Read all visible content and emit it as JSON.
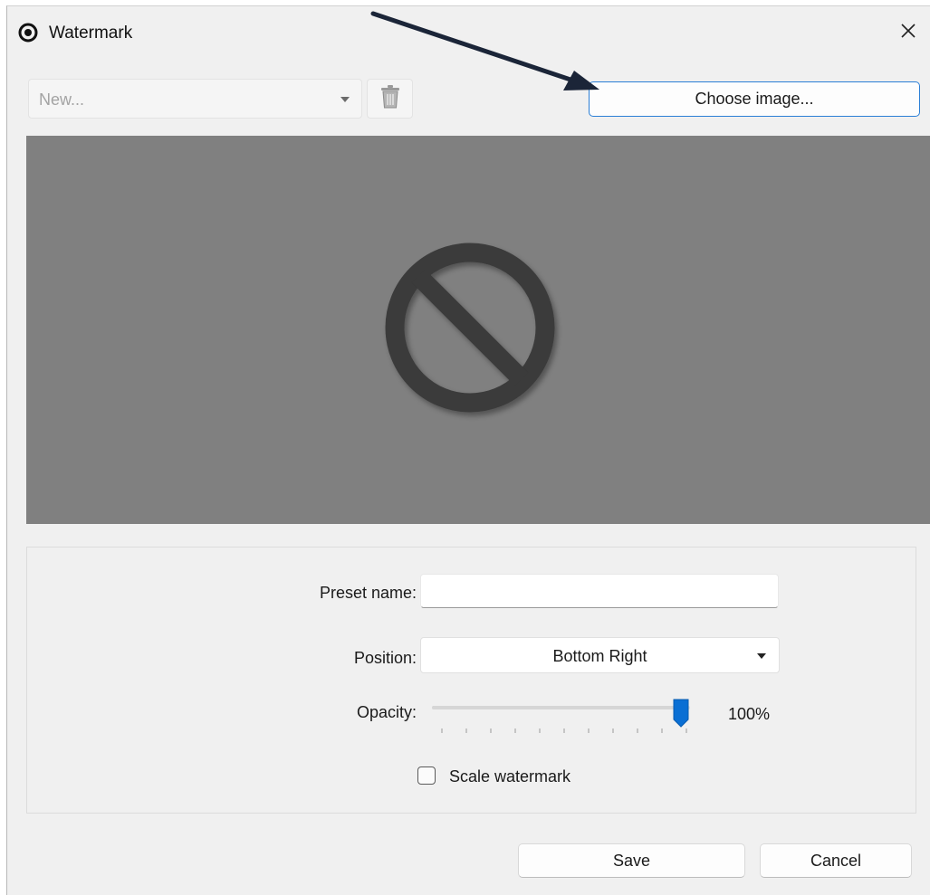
{
  "window": {
    "title": "Watermark",
    "app_icon": "radio-target-icon",
    "close_icon": "close-icon"
  },
  "toolbar": {
    "preset_select_value": "New...",
    "delete_icon": "trash-icon",
    "choose_image_label": "Choose image..."
  },
  "preview": {
    "icon": "no-image-icon",
    "background": "#808080"
  },
  "settings": {
    "preset_name_label": "Preset name:",
    "preset_name_value": "",
    "position_label": "Position:",
    "position_value": "Bottom Right",
    "opacity_label": "Opacity:",
    "opacity_value_text": "100%",
    "opacity_fraction": 1.0,
    "opacity_tick_count": 11,
    "scale_watermark_label": "Scale watermark",
    "scale_watermark_checked": false
  },
  "footer": {
    "save_label": "Save",
    "cancel_label": "Cancel"
  },
  "colors": {
    "accent": "#0a6fd4",
    "dialog_bg": "#f0f0f0",
    "preview_bg": "#808080",
    "annotation_arrow": "#1b2538"
  }
}
